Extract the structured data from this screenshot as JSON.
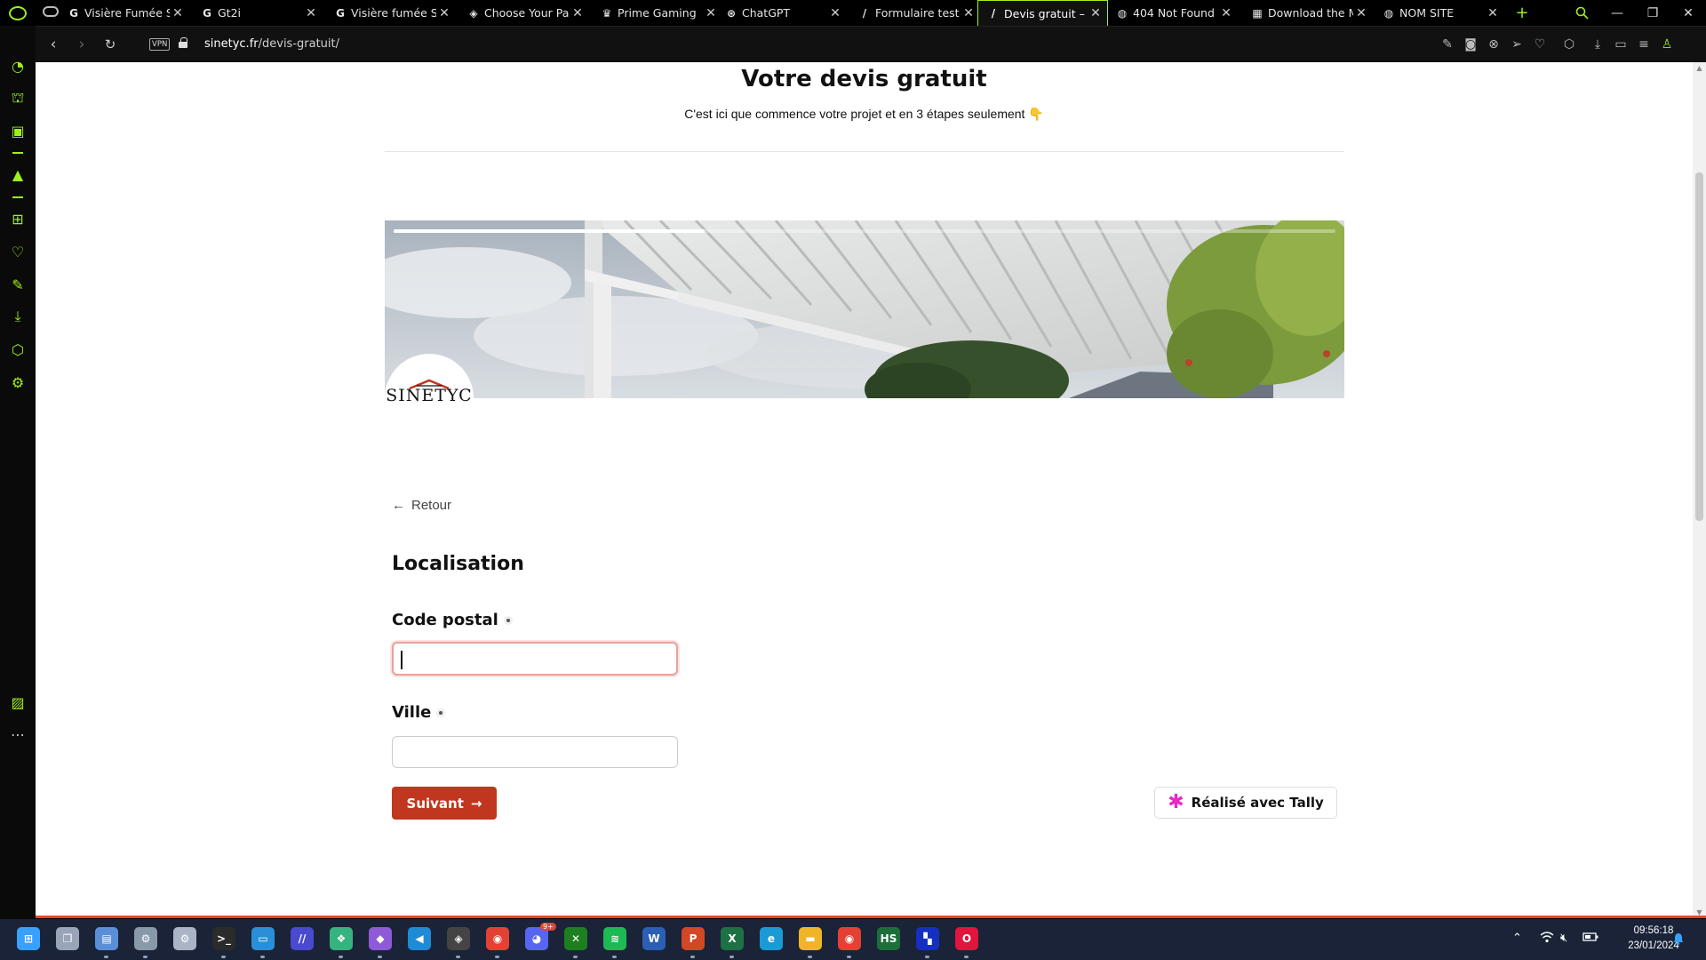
{
  "browser": {
    "tabs": [
      {
        "label": "Visière Fumée Sp",
        "favicon": "G",
        "active": false
      },
      {
        "label": "Gt2i",
        "favicon": "G",
        "active": false
      },
      {
        "label": "Visière fumée Sp",
        "favicon": "G",
        "active": false
      },
      {
        "label": "Choose Your Part",
        "favicon": "◈",
        "active": false
      },
      {
        "label": "Prime Gaming",
        "favicon": "♛",
        "active": false
      },
      {
        "label": "ChatGPT",
        "favicon": "⊛",
        "active": false
      },
      {
        "label": "Formulaire test -",
        "favicon": "/",
        "active": false
      },
      {
        "label": "Devis gratuit – Sir",
        "favicon": "/",
        "active": true
      },
      {
        "label": "404 Not Found",
        "favicon": "◍",
        "active": false
      },
      {
        "label": "Download the Mi",
        "favicon": "▦",
        "active": false
      },
      {
        "label": "NOM SITE",
        "favicon": "◍",
        "active": false
      }
    ],
    "url_host": "sinetyc.fr",
    "url_path": "/devis-gratuit/",
    "vpn_label": "VPN",
    "accent_color": "#9ef01a"
  },
  "page": {
    "title": "Votre devis gratuit",
    "subtitle": "C'est ici que commence votre projet et en 3 étapes seulement 👇",
    "progress_fraction": 0.33,
    "logo_text": "Sinetyc",
    "back_label": "Retour",
    "section_title": "Localisation",
    "postal_label": "Code postal",
    "postal_value": "",
    "city_label": "Ville",
    "city_value": "",
    "next_label": "Suivant",
    "tally_label": "Réalisé avec Tally",
    "button_color": "#c0361f"
  },
  "taskbar": {
    "apps": [
      {
        "name": "start",
        "glyph": "⊞",
        "color": "#3aa0ff"
      },
      {
        "name": "task-view",
        "glyph": "❐",
        "color": "#9aa4b8"
      },
      {
        "name": "monitor-app",
        "glyph": "▤",
        "color": "#5a8fd8"
      },
      {
        "name": "settings-app",
        "glyph": "⚙",
        "color": "#8899aa"
      },
      {
        "name": "control-app",
        "glyph": "⚙",
        "color": "#aab4c6"
      },
      {
        "name": "terminal-app",
        "glyph": ">_",
        "color": "#2b2b2b"
      },
      {
        "name": "remote-desktop",
        "glyph": "▭",
        "color": "#2a8fd6"
      },
      {
        "name": "pad-app",
        "glyph": "//",
        "color": "#4a4ad0"
      },
      {
        "name": "teams-like",
        "glyph": "❖",
        "color": "#36b37e"
      },
      {
        "name": "visual-studio",
        "glyph": "◆",
        "color": "#8e5ad8"
      },
      {
        "name": "vscode",
        "glyph": "◀",
        "color": "#1f8ad6"
      },
      {
        "name": "unity",
        "glyph": "◈",
        "color": "#444"
      },
      {
        "name": "chrome",
        "glyph": "◉",
        "color": "#e34133"
      },
      {
        "name": "discord",
        "glyph": "◕",
        "color": "#5865f2"
      },
      {
        "name": "xbox",
        "glyph": "✕",
        "color": "#1e7f1e"
      },
      {
        "name": "spotify",
        "glyph": "≋",
        "color": "#1db954"
      },
      {
        "name": "word",
        "glyph": "W",
        "color": "#2b5fb4"
      },
      {
        "name": "powerpoint",
        "glyph": "P",
        "color": "#d24726"
      },
      {
        "name": "excel",
        "glyph": "X",
        "color": "#1e7145"
      },
      {
        "name": "edge",
        "glyph": "e",
        "color": "#1a9bd6"
      },
      {
        "name": "file-explorer",
        "glyph": "▬",
        "color": "#f0b429"
      },
      {
        "name": "chrome-profile",
        "glyph": "◉",
        "color": "#e34133"
      },
      {
        "name": "hs-app",
        "glyph": "HS",
        "color": "#1d6f3a"
      },
      {
        "name": "ubisoft-like",
        "glyph": "▚",
        "color": "#1530c0"
      },
      {
        "name": "opera-gx",
        "glyph": "O",
        "color": "#e0143c"
      }
    ],
    "discord_badge": "9+",
    "time": "09:56:18",
    "date": "23/01/2024"
  }
}
